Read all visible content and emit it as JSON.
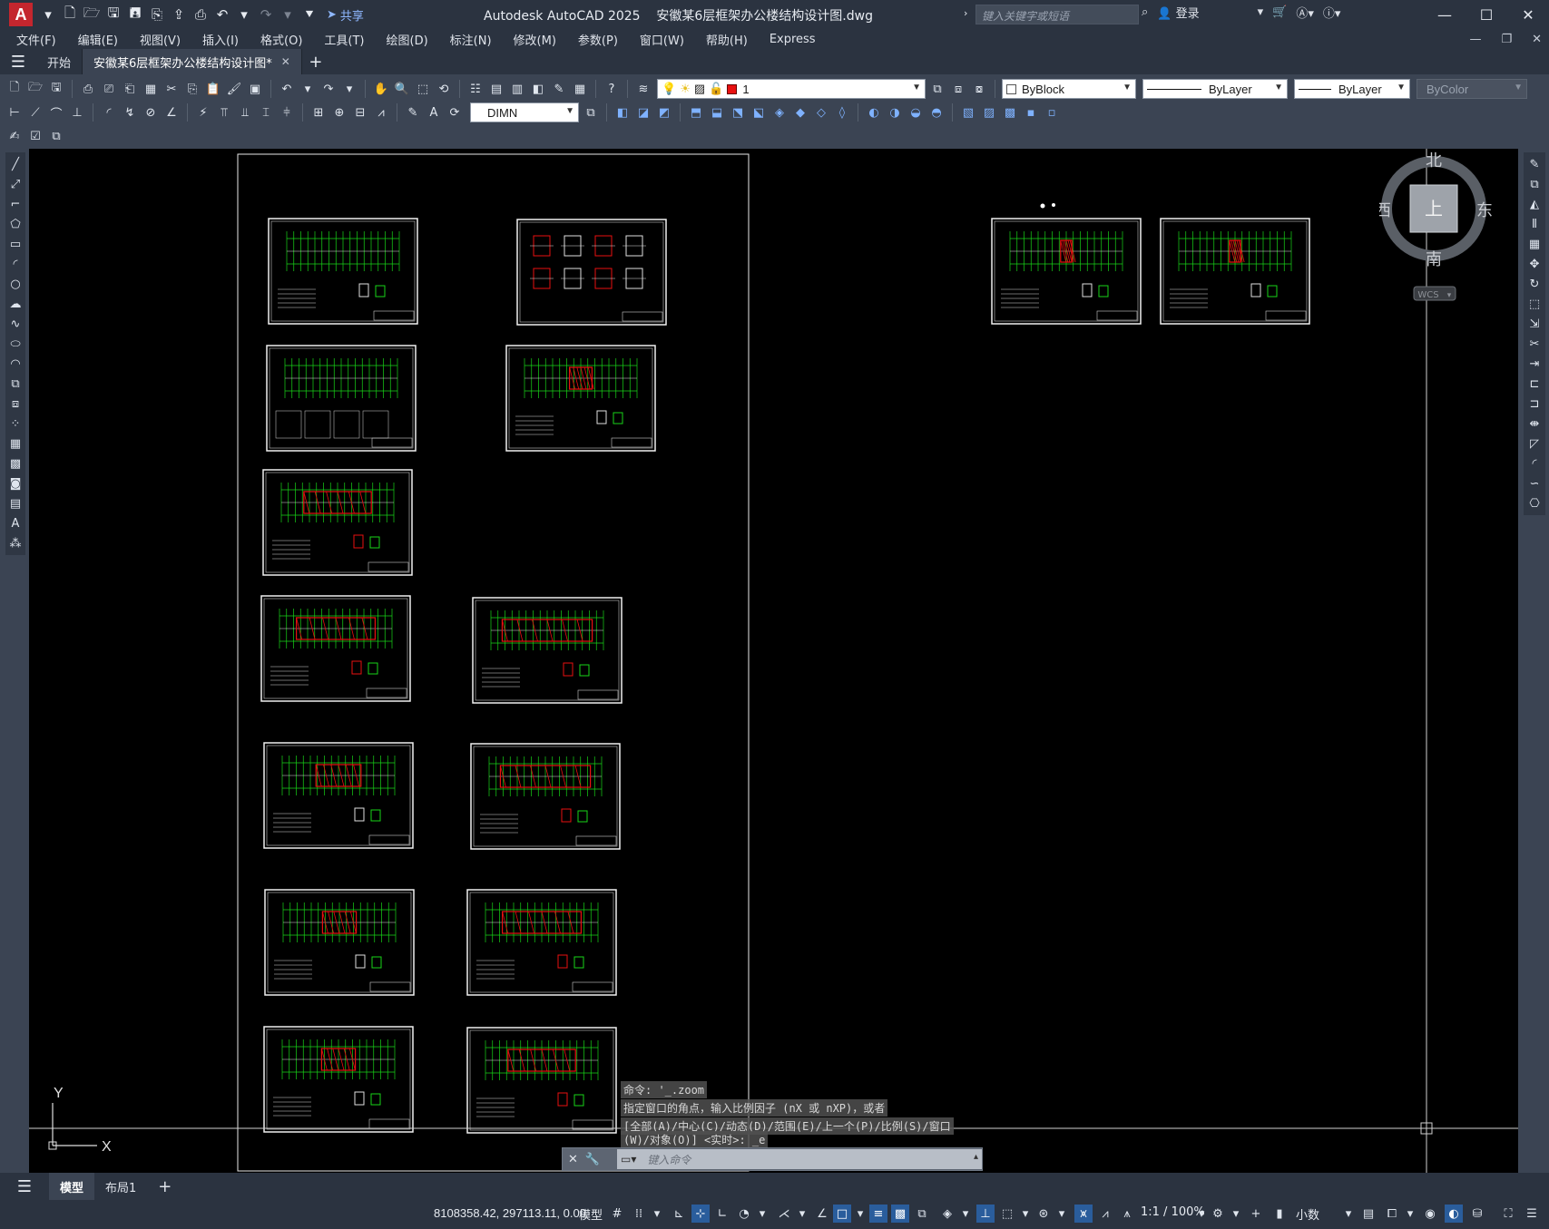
{
  "title_bar": {
    "logo_letter": "A",
    "share_label": "共享",
    "app_name": "Autodesk AutoCAD 2025",
    "file_name": "安徽某6层框架办公楼结构设计图.dwg",
    "search_placeholder": "键入关键字或短语",
    "login_label": "登录"
  },
  "menu": [
    "文件(F)",
    "编辑(E)",
    "视图(V)",
    "插入(I)",
    "格式(O)",
    "工具(T)",
    "绘图(D)",
    "标注(N)",
    "修改(M)",
    "参数(P)",
    "窗口(W)",
    "帮助(H)",
    "Express"
  ],
  "doc_tabs": [
    {
      "label": "开始",
      "active": false
    },
    {
      "label": "安徽某6层框架办公楼结构设计图*",
      "active": true
    }
  ],
  "properties": {
    "layer_name": "1",
    "layer_color": "#e81010",
    "color_combo": "ByBlock",
    "linetype_combo": "ByLayer",
    "lineweight_combo": "ByLayer",
    "plotstyle_combo": "ByColor",
    "dimstyle_combo": "DIMN"
  },
  "viewcube": {
    "north": "北",
    "south": "南",
    "east": "东",
    "west": "西",
    "face": "上",
    "wcs": "WCS"
  },
  "ucs": {
    "x_label": "X",
    "y_label": "Y"
  },
  "command_history": [
    "命令: '_.zoom",
    "指定窗口的角点，输入比例因子 (nX 或 nXP)，或者",
    "[全部(A)/中心(C)/动态(D)/范围(E)/上一个(P)/比例(S)/窗口",
    "(W)/对象(O)] <实时>: _e"
  ],
  "command_placeholder": "键入命令",
  "layout_tabs": [
    {
      "label": "模型",
      "active": true
    },
    {
      "label": "布局1",
      "active": false
    }
  ],
  "status": {
    "coordinates": "8108358.42, 297113.11, 0.00",
    "model_label": "模型",
    "scale_label": "1:1 / 100%",
    "units_label": "小数"
  },
  "colors": {
    "canvas": "#000000",
    "grid_green": "#18d418",
    "accent_red": "#e81010",
    "chrome_dark": "#2b3340",
    "chrome": "#3b4453"
  }
}
